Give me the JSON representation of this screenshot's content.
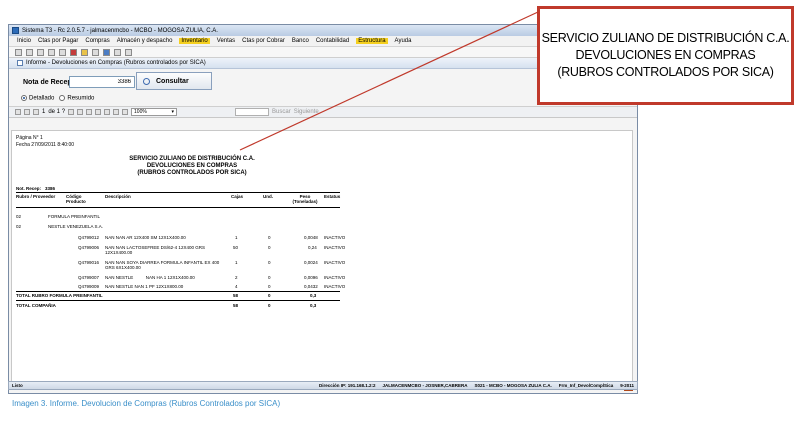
{
  "window": {
    "title": "Sistema T3 - Rc 2.0.5.7 - jalmacenmcbo - MCBO - MOGOSA ZULIA, C.A.",
    "buttons": [
      "_",
      "□",
      "X"
    ]
  },
  "menu": [
    "Inicio",
    "Ctas por Pagar",
    "Compras",
    "Almacén y despacho",
    "Inventario",
    "Ventas",
    "Ctas por Cobrar",
    "Banco",
    "Contabilidad",
    "Estructura",
    "Ayuda"
  ],
  "subwindow_title": "Informe - Devoluciones en Compras (Rubros controlados por SICA)",
  "form": {
    "nota_label": "Nota de Recepción:",
    "nota_value": "3386",
    "consultar_label": "Consultar",
    "radio_detallado": "Detallado",
    "radio_resumido": "Resumido"
  },
  "report_toolbar": {
    "page_current": "1",
    "page_of": "de 1 ?",
    "zoom": "100%",
    "find": "Buscar",
    "next": "Siguiente"
  },
  "report": {
    "page_no": "Página N° 1",
    "date": "Fecha 27/09/2011 8:40:00",
    "title_line1": "SERVICIO ZULIANO DE DISTRIBUCIÓN C.A.",
    "title_line2": "DEVOLUCIONES EN COMPRAS",
    "title_line3": "(RUBROS CONTROLADOS POR SICA)",
    "nota_label": "Not. Recep:",
    "nota_value": "3386",
    "headers": {
      "rubro": "Rubro / Proveedor",
      "codigo": "Código Producto",
      "descripcion": "Descripción",
      "cajas": "Cajas",
      "und": "Und.",
      "peso": "Peso (Toneladas)",
      "estatus": "Estatus"
    },
    "group_code": "02",
    "group_name": "FORMULA PREINFANTIL",
    "supplier_code": "02",
    "supplier_name": "NESTLE VENEZUELA S.A.",
    "rows": [
      {
        "codigo": "Q4799012",
        "descripcion": "NAN NAN AR 12X400 SM 12X1X400.00",
        "cajas": "1",
        "und": "0",
        "peso": "0,0048",
        "estatus": "INACTIVO"
      },
      {
        "codigo": "Q4799006",
        "descripcion": "NAN NAN LACTOSEFREE DS/62-4 12X400 GRS 12X1X400.00",
        "cajas": "50",
        "und": "0",
        "peso": "0,24",
        "estatus": "INACTIVO"
      },
      {
        "codigo": "Q4799016",
        "descripcion": "NAN NAN SOYA DIARREA FORMULA INFANTIL EX 400 GRS 6X1X400.00",
        "cajas": "1",
        "und": "0",
        "peso": "0,0024",
        "estatus": "INACTIVO"
      },
      {
        "codigo": "Q4799007",
        "descripcion": "NAN NESTLE          NAN HA 1 12X1X400.00",
        "cajas": "2",
        "und": "0",
        "peso": "0,0096",
        "estatus": "INACTIVO"
      },
      {
        "codigo": "Q4799009",
        "descripcion": "NAN NESTLE NAN 1 PF 12X1X800.00",
        "cajas": "4",
        "und": "0",
        "peso": "0,0432",
        "estatus": "INACTIVO"
      }
    ],
    "total_rubro_label": "TOTAL RUBRO FORMULA PREINFANTIL",
    "total_rubro": {
      "cajas": "58",
      "und": "0",
      "peso": "0,3"
    },
    "total_compania_label": "TOTAL COMPAÑIA",
    "total_compania": {
      "cajas": "58",
      "und": "0",
      "peso": "0,3"
    }
  },
  "status": {
    "left": "Listo",
    "ip": "Dirección IP: 191.168.1.2:2",
    "user": "JALMACENMCBO - JOSNER,CABRERA",
    "company": "S021 - MCBO - MOGOSA ZULIA C.A.",
    "form": "Frm_Inf_DevolComplSica",
    "year": "9-2011"
  },
  "caption": "Imagen 3.  Informe. Devolucion de Compras (Rubros Controlados por SICA)",
  "callout": {
    "line1": "SERVICIO ZULIANO DE DISTRIBUCIÓN C.A.",
    "line2": "DEVOLUCIONES EN COMPRAS",
    "line3": "(RUBROS CONTROLADOS POR SICA)"
  },
  "colors": {
    "callout_border": "#c0392b",
    "caption": "#3a8fc9",
    "menu_highlight": "#f5d020"
  }
}
